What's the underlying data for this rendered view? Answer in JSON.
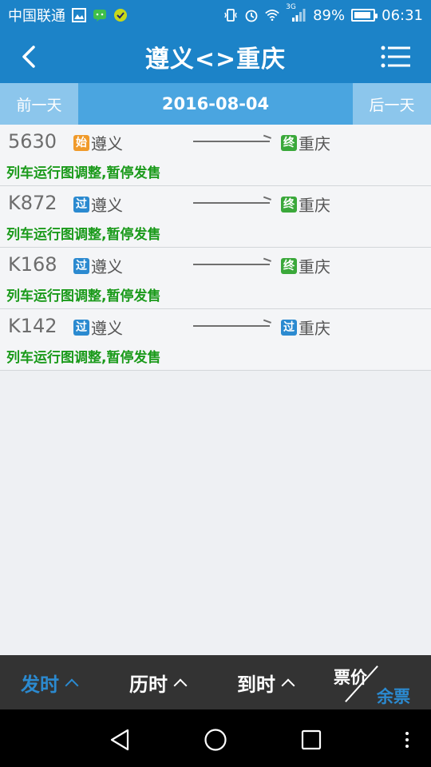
{
  "status_bar": {
    "carrier": "中国联通",
    "network": "3G",
    "battery": "89%",
    "battery_level": 0.89,
    "time": "06:31"
  },
  "header": {
    "title": "遵义<>重庆"
  },
  "date_bar": {
    "prev_label": "前一天",
    "date": "2016-08-04",
    "next_label": "后一天"
  },
  "trains": [
    {
      "number": "5630",
      "from_tag": "始",
      "from_tag_color": "#f09a2a",
      "from": "遵义",
      "to_tag": "终",
      "to_tag_color": "#3aa83a",
      "to": "重庆",
      "note": "列车运行图调整,暂停发售"
    },
    {
      "number": "K872",
      "from_tag": "过",
      "from_tag_color": "#2b8ad0",
      "from": "遵义",
      "to_tag": "终",
      "to_tag_color": "#3aa83a",
      "to": "重庆",
      "note": "列车运行图调整,暂停发售"
    },
    {
      "number": "K168",
      "from_tag": "过",
      "from_tag_color": "#2b8ad0",
      "from": "遵义",
      "to_tag": "终",
      "to_tag_color": "#3aa83a",
      "to": "重庆",
      "note": "列车运行图调整,暂停发售"
    },
    {
      "number": "K142",
      "from_tag": "过",
      "from_tag_color": "#2b8ad0",
      "from": "遵义",
      "to_tag": "过",
      "to_tag_color": "#2b8ad0",
      "to": "重庆",
      "note": "列车运行图调整,暂停发售"
    }
  ],
  "sort_bar": {
    "depart_label": "发时",
    "duration_label": "历时",
    "arrive_label": "到时",
    "price_label": "票价",
    "remaining_label": "余票"
  },
  "colors": {
    "primary": "#1c83c8",
    "accent_blue": "#2b8ad0",
    "note_green": "#1a9a1a"
  }
}
